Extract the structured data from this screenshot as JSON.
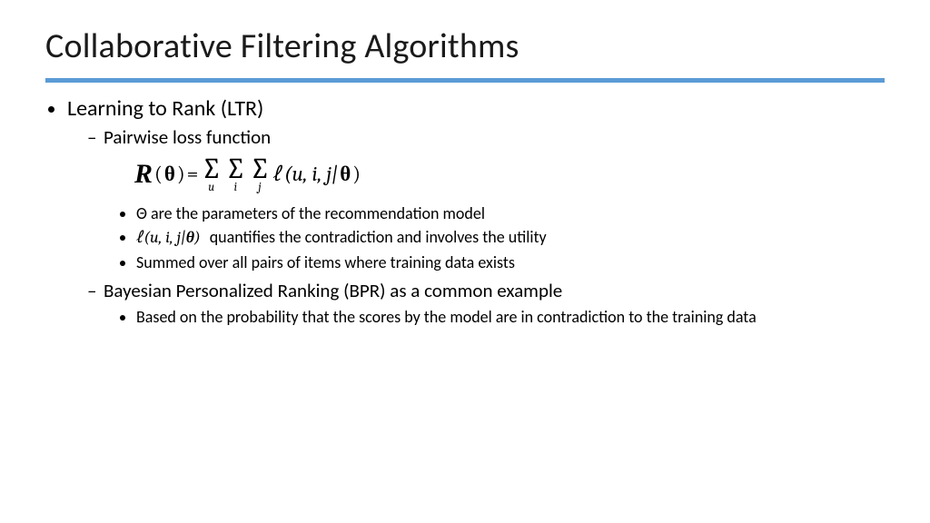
{
  "title": "Collaborative Filtering Algorithms",
  "l1": {
    "items": [
      {
        "label": "Learning to Rank (LTR)"
      }
    ]
  },
  "l2": {
    "a": "Pairwise loss function",
    "b": "Bayesian Personalized Ranking (BPR) as a common example"
  },
  "formula": {
    "R": "R",
    "lparen": "(",
    "theta": "θ",
    "rparen": ")",
    "eq": " = ",
    "sum_u": "u",
    "sum_i": "i",
    "sum_j": "j",
    "ell": "ℓ",
    "args": "(u, i, j|",
    "close": ")"
  },
  "l3a": {
    "i0": "Θ are the parameters of the recommendation model",
    "i1_math": "ℓ(u, i, j|θ)",
    "i1_text": " quantifies the contradiction and involves the utility",
    "i2": "Summed over all pairs of items where training data exists"
  },
  "l3b": {
    "i0": "Based on the probability that the scores by the model are in contradiction to the training data"
  }
}
